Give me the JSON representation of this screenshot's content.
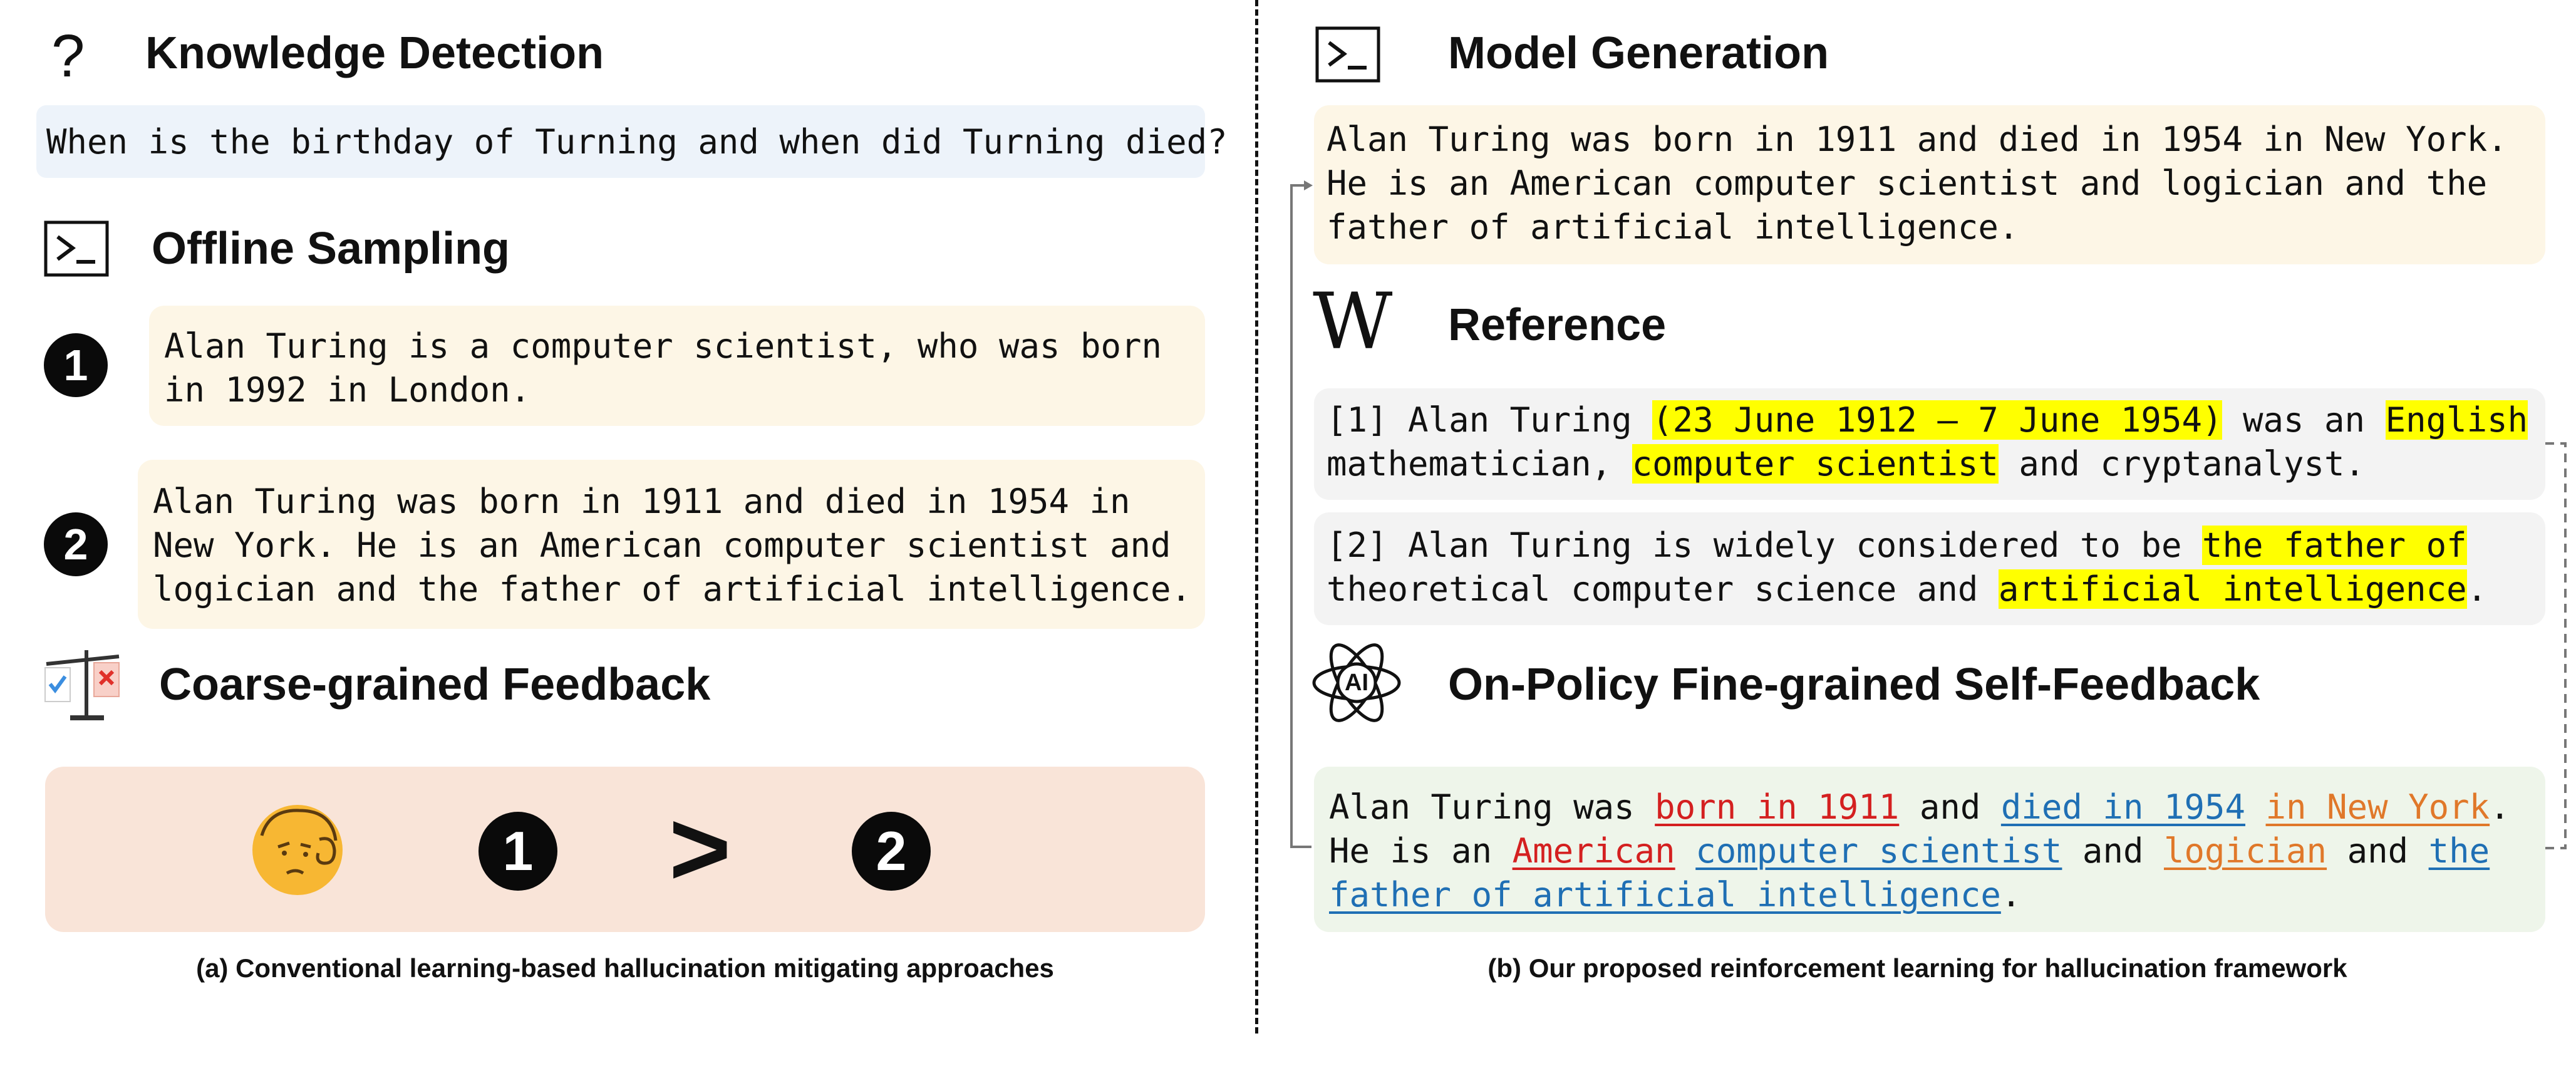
{
  "left": {
    "knowledge_detection": {
      "title": "Knowledge Detection",
      "question": "When is the birthday of Turning and when did Turning died?"
    },
    "offline_sampling": {
      "title": "Offline Sampling",
      "samples": [
        {
          "number": "1",
          "lines": [
            "Alan Turing is a computer scientist, who was born",
            "in 1992 in London."
          ]
        },
        {
          "number": "2",
          "lines": [
            "Alan Turing was born in 1911 and died in 1954 in",
            "New York. He is an American computer scientist and",
            "logician and the father of artificial intelligence."
          ]
        }
      ]
    },
    "coarse_feedback": {
      "title": "Coarse-grained Feedback",
      "comparison": {
        "left": "1",
        "op": ">",
        "right": "2"
      }
    },
    "caption": "(a) Conventional learning-based hallucination mitigating approaches"
  },
  "right": {
    "model_generation": {
      "title": "Model Generation",
      "lines": [
        "Alan Turing was born in 1911 and died in 1954 in New York.",
        "He is an American computer scientist and logician and the",
        "father of artificial intelligence."
      ]
    },
    "reference": {
      "title": "Reference",
      "refs": [
        {
          "lines": [
            [
              {
                "t": "[1] Alan Turing "
              },
              {
                "t": "(23 June 1912 – 7 June 1954)",
                "s": "hl"
              },
              {
                "t": " was an "
              },
              {
                "t": "English",
                "s": "hl"
              }
            ],
            [
              {
                "t": "mathematician, "
              },
              {
                "t": "computer scientist",
                "s": "hl"
              },
              {
                "t": " and cryptanalyst."
              }
            ]
          ]
        },
        {
          "lines": [
            [
              {
                "t": "[2] Alan Turing is widely considered to be "
              },
              {
                "t": "the father of",
                "s": "hl"
              }
            ],
            [
              {
                "t": "theoretical computer science and "
              },
              {
                "t": "artificial intelligence",
                "s": "hl"
              },
              {
                "t": "."
              }
            ]
          ]
        }
      ]
    },
    "self_feedback": {
      "title": "On-Policy Fine-grained Self-Feedback",
      "icon_label": "AI",
      "lines": [
        [
          {
            "t": "Alan Turing was "
          },
          {
            "t": "born in 1911",
            "s": "red"
          },
          {
            "t": " and "
          },
          {
            "t": "died in 1954",
            "s": "blue"
          },
          {
            "t": " "
          },
          {
            "t": "in New York",
            "s": "orange"
          },
          {
            "t": "."
          }
        ],
        [
          {
            "t": "He is an "
          },
          {
            "t": "American",
            "s": "red"
          },
          {
            "t": " "
          },
          {
            "t": "computer scientist",
            "s": "blue"
          },
          {
            "t": " and "
          },
          {
            "t": "logician",
            "s": "orange"
          },
          {
            "t": " and "
          },
          {
            "t": "the",
            "s": "blue"
          }
        ],
        [
          {
            "t": "father of artificial intelligence",
            "s": "blue"
          },
          {
            "t": "."
          }
        ]
      ]
    },
    "caption": "(b) Our proposed reinforcement learning for hallucination framework"
  },
  "colors": {
    "question_bg": "#edf3fa",
    "sample_bg": "#fdf6e6",
    "feedback_bg": "#f9e4d8",
    "reference_bg": "#f3f3f3",
    "self_feedback_bg": "#eef5ea",
    "highlight": "#ffff00",
    "red": "#d42020",
    "blue": "#1f6fb4",
    "orange": "#e0782a"
  }
}
